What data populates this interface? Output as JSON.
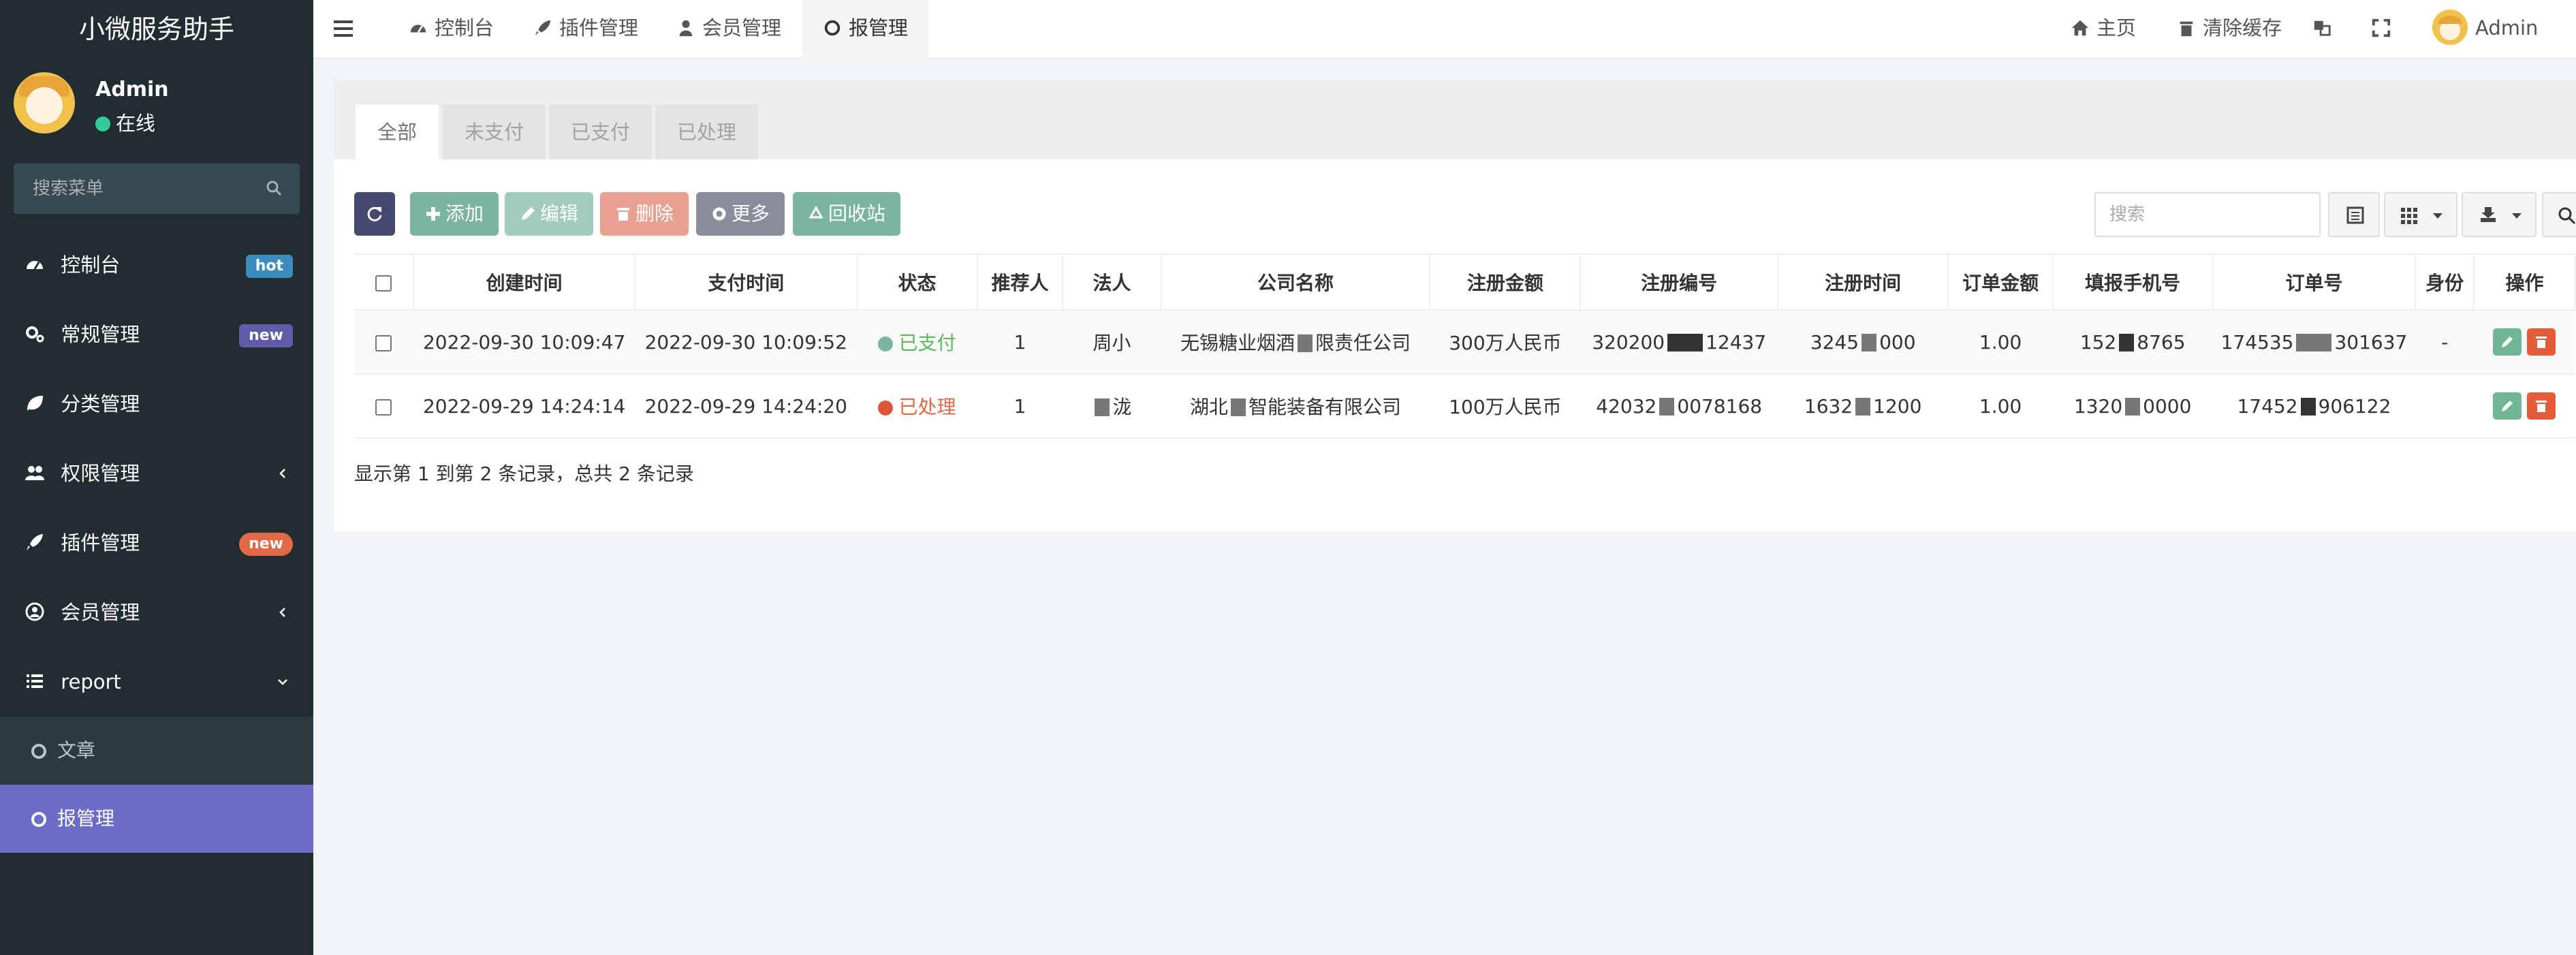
{
  "sidebar": {
    "brand": "小微服务助手",
    "user": {
      "name": "Admin",
      "status": "在线"
    },
    "search_placeholder": "搜索菜单",
    "items": [
      {
        "label": "控制台",
        "icon": "dashboard-icon",
        "badge": "hot"
      },
      {
        "label": "常规管理",
        "icon": "cogs-icon",
        "badge": "new"
      },
      {
        "label": "分类管理",
        "icon": "leaf-icon"
      },
      {
        "label": "权限管理",
        "icon": "users-icon"
      },
      {
        "label": "插件管理",
        "icon": "rocket-icon",
        "badge": "new"
      },
      {
        "label": "会员管理",
        "icon": "user-circle-icon"
      },
      {
        "label": "report",
        "icon": "list-icon"
      }
    ],
    "subitems": [
      {
        "label": "文章"
      },
      {
        "label": "报管理"
      }
    ]
  },
  "topbar": {
    "tabs": [
      {
        "label": "控制台",
        "icon": "dashboard-icon"
      },
      {
        "label": "插件管理",
        "icon": "rocket-icon"
      },
      {
        "label": "会员管理",
        "icon": "user-icon"
      },
      {
        "label": "报管理",
        "icon": "circle-icon"
      }
    ],
    "home_label": "主页",
    "clear_cache_label": "清除缓存",
    "user_label": "Admin"
  },
  "content": {
    "tabs": [
      "全部",
      "未支付",
      "已支付",
      "已处理"
    ],
    "toolbar": {
      "add": "添加",
      "edit": "编辑",
      "delete": "删除",
      "more": "更多",
      "recycle": "回收站",
      "search_placeholder": "搜索"
    },
    "table": {
      "columns": [
        "创建时间",
        "支付时间",
        "状态",
        "推荐人",
        "法人",
        "公司名称",
        "注册金额",
        "注册编号",
        "注册时间",
        "订单金额",
        "填报手机号",
        "订单号",
        "身份",
        "操作"
      ],
      "rows": [
        {
          "created": "2022-09-30 10:09:47",
          "paid": "2022-09-30 10:09:52",
          "status": "已支付",
          "referrer": "1",
          "legal_a": "周小",
          "company_a": "无锡糖业烟酒",
          "company_b": "限责任公司",
          "capital": "300万人民币",
          "reg_a": "320200",
          "reg_b": "12437",
          "reg_time_a": "3245",
          "reg_time_b": "000",
          "amount": "1.00",
          "phone_a": "152",
          "phone_b": "8765",
          "order_a": "174535",
          "order_b": "301637",
          "identity": "-"
        },
        {
          "created": "2022-09-29 14:24:14",
          "paid": "2022-09-29 14:24:20",
          "status": "已处理",
          "referrer": "1",
          "legal_a": "",
          "legal_b": "泷",
          "company_a": "湖北",
          "company_b": "智能装备有限公司",
          "capital": "100万人民币",
          "reg_a": "42032",
          "reg_b": "0078168",
          "reg_time_a": "1632",
          "reg_time_b": "1200",
          "amount": "1.00",
          "phone_a": "1320",
          "phone_b": "0000",
          "order_a": "17452",
          "order_b": "906122",
          "identity": ""
        }
      ]
    },
    "footer": "显示第 1 到第 2 条记录，总共 2 条记录"
  },
  "colors": {
    "sidebar_bg": "#222d32",
    "active_sub": "#6c6cc9",
    "paid": "#5cb85c",
    "processed": "#e06a45"
  }
}
